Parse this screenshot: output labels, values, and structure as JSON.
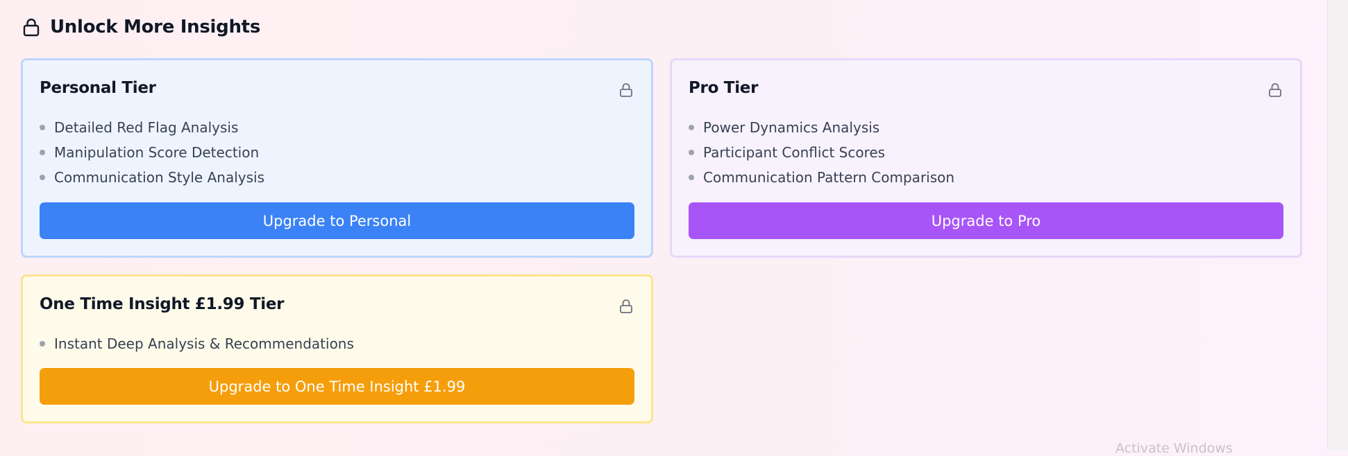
{
  "section": {
    "title": "Unlock More Insights",
    "icon": "lock-icon"
  },
  "cards": [
    {
      "title": "Personal Tier",
      "icon": "lock-icon",
      "features": [
        "Detailed Red Flag Analysis",
        "Manipulation Score Detection",
        "Communication Style Analysis"
      ],
      "button_label": "Upgrade to Personal",
      "accent": "#3b82f6"
    },
    {
      "title": "Pro Tier",
      "icon": "lock-icon",
      "features": [
        "Power Dynamics Analysis",
        "Participant Conflict Scores",
        "Communication Pattern Comparison"
      ],
      "button_label": "Upgrade to Pro",
      "accent": "#a855f7"
    },
    {
      "title": "One Time Insight £1.99 Tier",
      "icon": "lock-icon",
      "features": [
        "Instant Deep Analysis & Recommendations"
      ],
      "button_label": "Upgrade to One Time Insight £1.99",
      "accent": "#f59e0b"
    }
  ],
  "system": {
    "watermark": "Activate Windows"
  }
}
